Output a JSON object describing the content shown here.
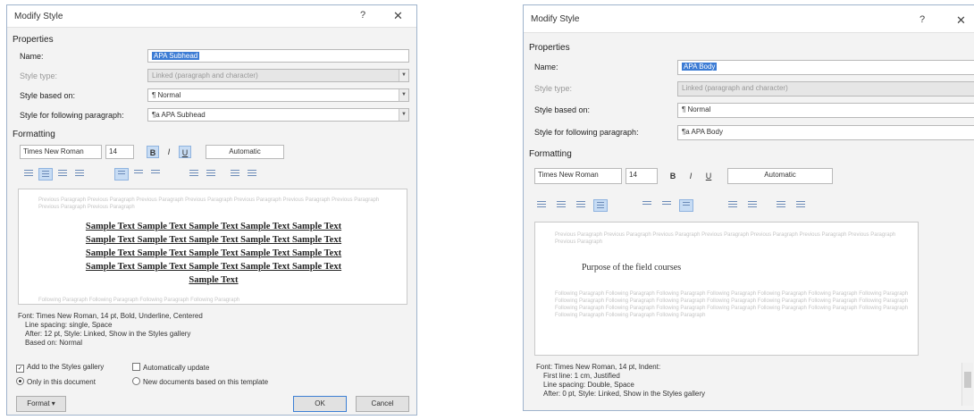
{
  "left": {
    "title": "Modify Style",
    "help": "?",
    "close": "✕",
    "properties": "Properties",
    "name_label": "Name:",
    "name_value": "APA Subhead",
    "style_type_label": "Style type:",
    "style_type_value": "Linked (paragraph and character)",
    "based_on_label": "Style based on:",
    "based_on_value": "¶ Normal",
    "following_label": "Style for following paragraph:",
    "following_value": "¶a APA Subhead",
    "formatting": "Formatting",
    "font": "Times New Roman",
    "size": "14",
    "bold": "B",
    "italic": "I",
    "underline": "U",
    "color": "Automatic",
    "preview_prev": "Previous Paragraph Previous Paragraph Previous Paragraph Previous Paragraph Previous Paragraph Previous Paragraph Previous Paragraph Previous Paragraph Previous Paragraph",
    "preview_sample": [
      "Sample Text Sample Text Sample Text Sample Text Sample Text",
      "Sample Text Sample Text Sample Text Sample Text Sample Text",
      "Sample Text Sample Text Sample Text Sample Text Sample Text",
      "Sample Text Sample Text Sample Text Sample Text Sample Text",
      "Sample Text"
    ],
    "preview_next": "Following Paragraph Following Paragraph Following Paragraph Following Paragraph",
    "desc": [
      "Font: Times New Roman, 14 pt, Bold, Underline, Centered",
      "Line spacing: single, Space",
      "After: 12 pt, Style: Linked, Show in the Styles gallery",
      "Based on: Normal"
    ],
    "add_gallery": "Add to the Styles gallery",
    "auto_update": "Automatically update",
    "only_doc": "Only in this document",
    "new_docs": "New documents based on this template",
    "format_btn": "Format ▾",
    "ok_btn": "OK",
    "cancel_btn": "Cancel"
  },
  "right": {
    "title": "Modify Style",
    "help": "?",
    "close": "✕",
    "properties": "Properties",
    "name_label": "Name:",
    "name_value": "APA Body",
    "style_type_label": "Style type:",
    "style_type_value": "Linked (paragraph and character)",
    "based_on_label": "Style based on:",
    "based_on_value": "¶ Normal",
    "following_label": "Style for following paragraph:",
    "following_value": "¶a APA Body",
    "formatting": "Formatting",
    "font": "Times New Roman",
    "size": "14",
    "bold": "B",
    "italic": "I",
    "underline": "U",
    "color": "Automatic",
    "preview_prev": "Previous Paragraph Previous Paragraph Previous Paragraph Previous Paragraph Previous Paragraph Previous Paragraph Previous Paragraph Previous Paragraph",
    "preview_main": "Purpose of the field courses",
    "preview_next": "Following Paragraph Following Paragraph Following Paragraph Following Paragraph Following Paragraph Following Paragraph Following Paragraph Following Paragraph Following Paragraph Following Paragraph Following Paragraph Following Paragraph Following Paragraph Following Paragraph Following Paragraph Following Paragraph Following Paragraph Following Paragraph Following Paragraph Following Paragraph Following Paragraph Following Paragraph Following Paragraph Following Paragraph",
    "desc": [
      "Font: Times New Roman, 14 pt, Indent:",
      "First line: 1 cm, Justified",
      "Line spacing: Double, Space",
      "After: 0 pt, Style: Linked, Show in the Styles gallery"
    ]
  }
}
